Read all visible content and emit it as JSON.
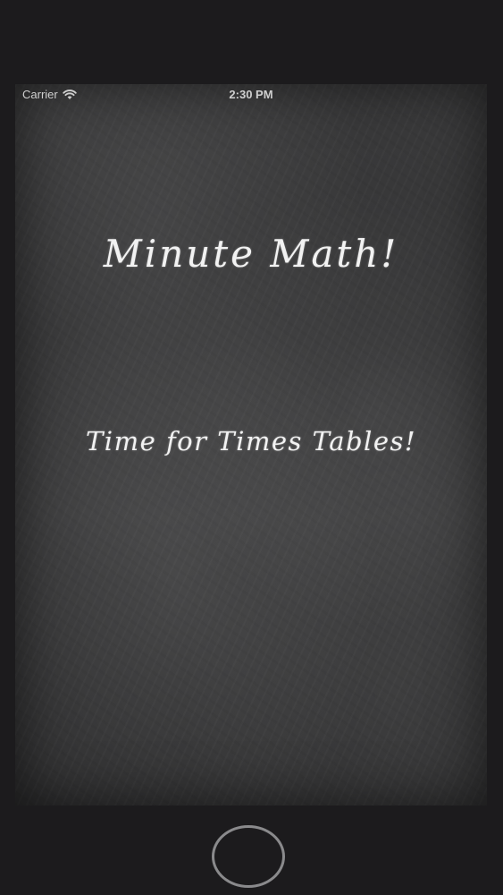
{
  "status_bar": {
    "carrier": "Carrier",
    "time": "2:30 PM",
    "wifi_icon": "wifi-icon",
    "battery_icon": "battery-icon"
  },
  "app": {
    "title": "Minute Math!",
    "subtitle": "Time for Times Tables!"
  },
  "device": {
    "home_button_icon": "home-button"
  },
  "colors": {
    "bezel": "#1c1b1d",
    "chalkboard": "#3a3a3b",
    "chalk_text": "#f2f2f2",
    "home_button_ring": "#8a8a8c"
  }
}
